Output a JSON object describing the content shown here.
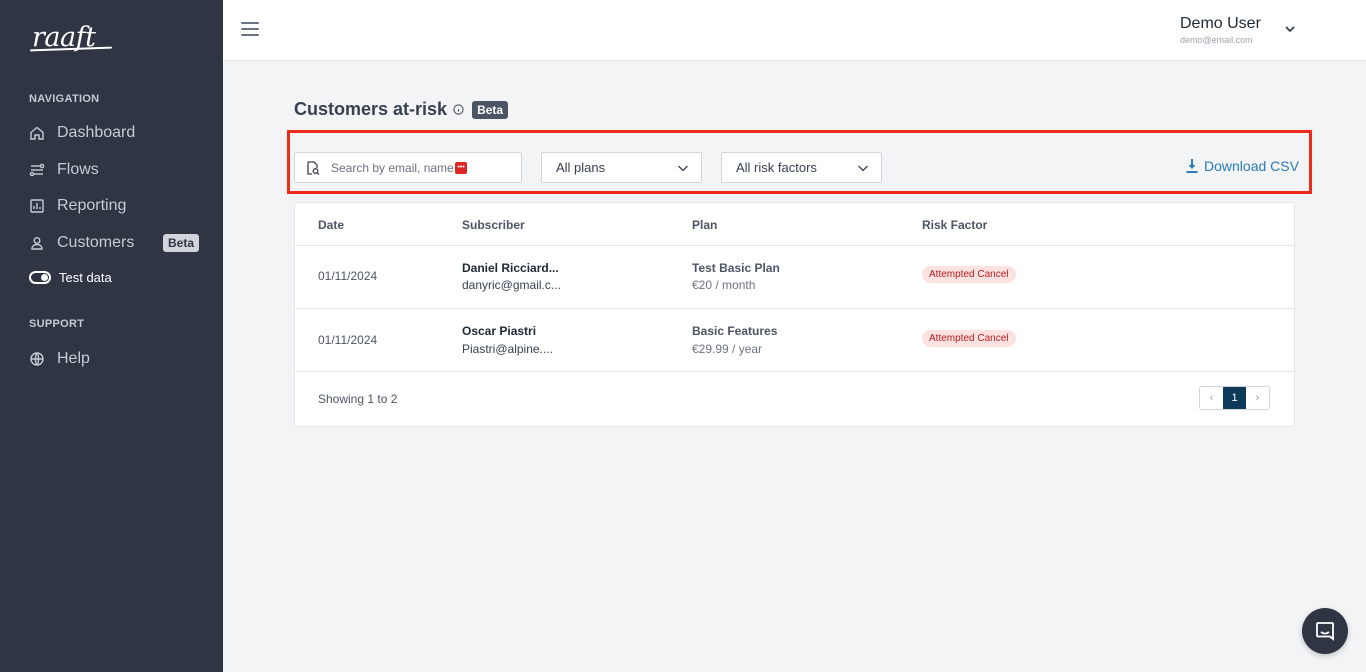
{
  "brand": {
    "logo_text": "raaft"
  },
  "sidebar": {
    "navigation_label": "NAVIGATION",
    "items": [
      {
        "label": "Dashboard",
        "icon": "home-icon"
      },
      {
        "label": "Flows",
        "icon": "flows-icon"
      },
      {
        "label": "Reporting",
        "icon": "chart-icon"
      },
      {
        "label": "Customers",
        "icon": "user-icon",
        "badge": "Beta"
      }
    ],
    "test_data_label": "Test data",
    "support_label": "SUPPORT",
    "help_label": "Help"
  },
  "header": {
    "user_name": "Demo User",
    "user_email": "demo@email.com"
  },
  "page": {
    "title": "Customers at-risk",
    "title_badge": "Beta"
  },
  "filters": {
    "search_placeholder": "Search by email, name",
    "plans_selected": "All plans",
    "risk_selected": "All risk factors",
    "download_label": "Download CSV"
  },
  "table": {
    "headers": [
      "Date",
      "Subscriber",
      "Plan",
      "Risk Factor"
    ],
    "rows": [
      {
        "date": "01/11/2024",
        "name": "Daniel Ricciard...",
        "email": "danyric@gmail.c...",
        "plan": "Test Basic Plan",
        "price": "€20 / month",
        "risk": "Attempted Cancel"
      },
      {
        "date": "01/11/2024",
        "name": "Oscar Piastri",
        "email": "Piastri@alpine....",
        "plan": "Basic Features",
        "price": "€29.99 / year",
        "risk": "Attempted Cancel"
      }
    ],
    "showing": "Showing 1 to 2",
    "pager": {
      "prev": "‹",
      "current": "1",
      "next": "›"
    }
  },
  "colors": {
    "sidebar_bg": "#2f3542",
    "accent_link": "#2b7bb9",
    "highlight_border": "#ee2a1b",
    "risk_badge_bg": "#fde2e2",
    "risk_badge_text": "#b91c1c",
    "pager_active": "#0f3b5a"
  }
}
